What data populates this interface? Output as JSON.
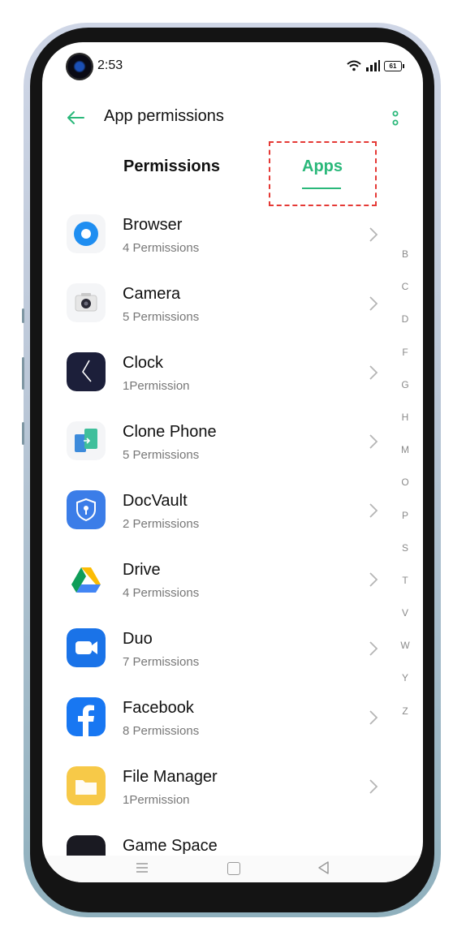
{
  "status_bar": {
    "time": "2:53",
    "battery": "61"
  },
  "header": {
    "title": "App permissions"
  },
  "tabs": [
    {
      "label": "Permissions",
      "selected": false
    },
    {
      "label": "Apps",
      "selected": true
    }
  ],
  "apps": [
    {
      "name": "Browser",
      "permissions": "4 Permissions",
      "icon": "browser-icon"
    },
    {
      "name": "Camera",
      "permissions": "5 Permissions",
      "icon": "camera-icon"
    },
    {
      "name": "Clock",
      "permissions": "1Permission",
      "icon": "clock-icon"
    },
    {
      "name": "Clone Phone",
      "permissions": "5 Permissions",
      "icon": "clone-phone-icon"
    },
    {
      "name": "DocVault",
      "permissions": "2 Permissions",
      "icon": "docvault-icon"
    },
    {
      "name": "Drive",
      "permissions": "4 Permissions",
      "icon": "drive-icon"
    },
    {
      "name": "Duo",
      "permissions": "7 Permissions",
      "icon": "duo-icon"
    },
    {
      "name": "Facebook",
      "permissions": "8 Permissions",
      "icon": "facebook-icon"
    },
    {
      "name": "File Manager",
      "permissions": "1Permission",
      "icon": "file-manager-icon"
    },
    {
      "name": "Game Space",
      "permissions": "",
      "icon": "game-space-icon"
    }
  ],
  "index_letters": [
    "B",
    "C",
    "D",
    "F",
    "G",
    "H",
    "M",
    "O",
    "P",
    "S",
    "T",
    "V",
    "W",
    "Y",
    "Z"
  ],
  "colors": {
    "accent": "#2ab87a",
    "highlight_box": "#e53935"
  }
}
